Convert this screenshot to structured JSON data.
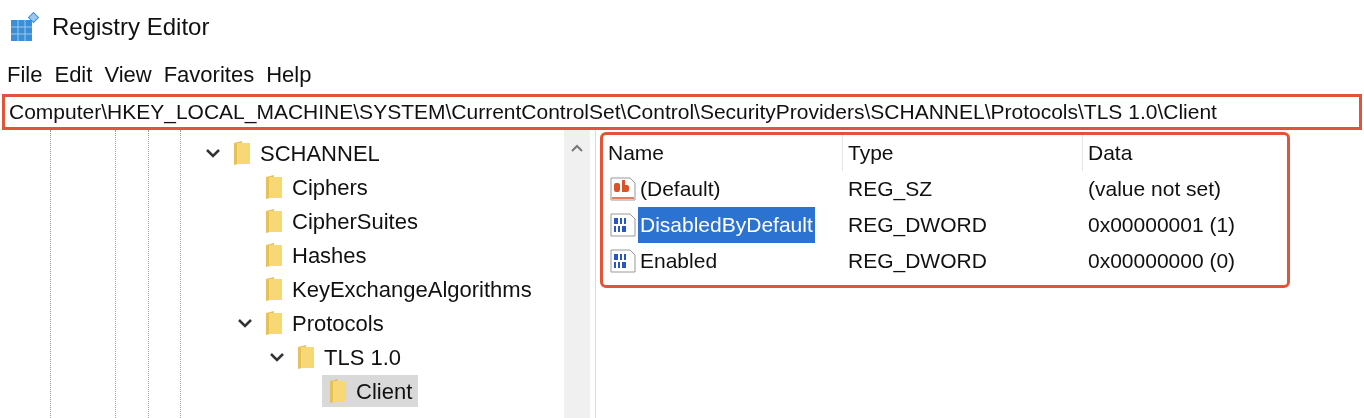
{
  "window": {
    "title": "Registry Editor"
  },
  "menu": [
    "File",
    "Edit",
    "View",
    "Favorites",
    "Help"
  ],
  "address": "Computer\\HKEY_LOCAL_MACHINE\\SYSTEM\\CurrentControlSet\\Control\\SecurityProviders\\SCHANNEL\\Protocols\\TLS 1.0\\Client",
  "tree": [
    {
      "label": "SCHANNEL",
      "expanded": true,
      "selected": false,
      "children": [
        {
          "label": "Ciphers",
          "selected": false
        },
        {
          "label": "CipherSuites",
          "selected": false
        },
        {
          "label": "Hashes",
          "selected": false
        },
        {
          "label": "KeyExchangeAlgorithms",
          "selected": false
        },
        {
          "label": "Protocols",
          "expanded": true,
          "selected": false,
          "children": [
            {
              "label": "TLS 1.0",
              "expanded": true,
              "selected": false,
              "children": [
                {
                  "label": "Client",
                  "selected": true
                }
              ]
            }
          ]
        }
      ]
    }
  ],
  "values": {
    "columns": [
      "Name",
      "Type",
      "Data"
    ],
    "rows": [
      {
        "kind": "string",
        "name": "(Default)",
        "type": "REG_SZ",
        "data": "(value not set)",
        "selected": false
      },
      {
        "kind": "binary",
        "name": "DisabledByDefault",
        "type": "REG_DWORD",
        "data": "0x00000001 (1)",
        "selected": true
      },
      {
        "kind": "binary",
        "name": "Enabled",
        "type": "REG_DWORD",
        "data": "0x00000000 (0)",
        "selected": false
      }
    ]
  }
}
